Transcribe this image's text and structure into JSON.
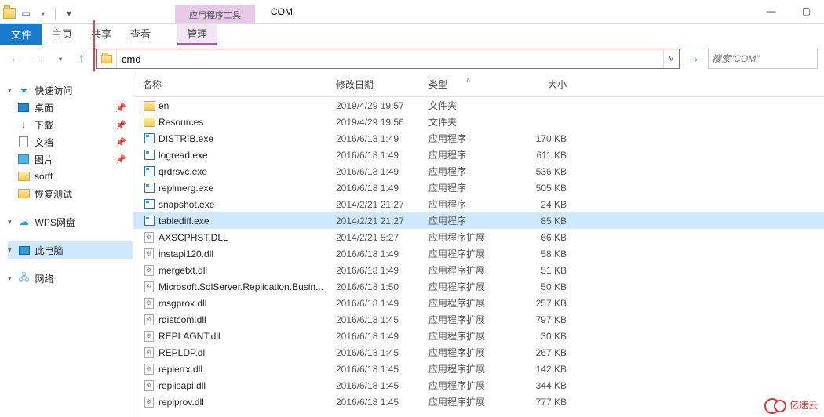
{
  "window": {
    "title": "COM",
    "tools_label": "应用程序工具"
  },
  "ribbon": {
    "file": "文件",
    "home": "主页",
    "share": "共享",
    "view": "查看",
    "manage": "管理"
  },
  "address": {
    "value": "cmd"
  },
  "search": {
    "placeholder": "搜索\"COM\""
  },
  "sidebar": {
    "quick_access": "快速访问",
    "items": [
      {
        "label": "桌面",
        "icon": "desktop",
        "pinned": true
      },
      {
        "label": "下载",
        "icon": "download",
        "pinned": true
      },
      {
        "label": "文档",
        "icon": "doc",
        "pinned": true
      },
      {
        "label": "图片",
        "icon": "pic",
        "pinned": true
      },
      {
        "label": "sorft",
        "icon": "folder",
        "pinned": false
      },
      {
        "label": "恢复测试",
        "icon": "folder",
        "pinned": false
      }
    ],
    "wps": "WPS网盘",
    "this_pc": "此电脑",
    "network": "网络"
  },
  "columns": {
    "name": "名称",
    "date": "修改日期",
    "type": "类型",
    "size": "大小"
  },
  "files": [
    {
      "name": "en",
      "date": "2019/4/29 19:57",
      "type": "文件夹",
      "size": "",
      "icon": "folder"
    },
    {
      "name": "Resources",
      "date": "2019/4/29 19:56",
      "type": "文件夹",
      "size": "",
      "icon": "folder"
    },
    {
      "name": "DISTRIB.exe",
      "date": "2016/6/18 1:49",
      "type": "应用程序",
      "size": "170 KB",
      "icon": "exe"
    },
    {
      "name": "logread.exe",
      "date": "2016/6/18 1:49",
      "type": "应用程序",
      "size": "611 KB",
      "icon": "exe"
    },
    {
      "name": "qrdrsvc.exe",
      "date": "2016/6/18 1:49",
      "type": "应用程序",
      "size": "536 KB",
      "icon": "exe"
    },
    {
      "name": "replmerg.exe",
      "date": "2016/6/18 1:49",
      "type": "应用程序",
      "size": "505 KB",
      "icon": "exe"
    },
    {
      "name": "snapshot.exe",
      "date": "2014/2/21 21:27",
      "type": "应用程序",
      "size": "24 KB",
      "icon": "exe"
    },
    {
      "name": "tablediff.exe",
      "date": "2014/2/21 21:27",
      "type": "应用程序",
      "size": "85 KB",
      "icon": "exe",
      "selected": true
    },
    {
      "name": "AXSCPHST.DLL",
      "date": "2014/2/21 5:27",
      "type": "应用程序扩展",
      "size": "66 KB",
      "icon": "dll"
    },
    {
      "name": "instapi120.dll",
      "date": "2016/6/18 1:49",
      "type": "应用程序扩展",
      "size": "58 KB",
      "icon": "dll"
    },
    {
      "name": "mergetxt.dll",
      "date": "2016/6/18 1:49",
      "type": "应用程序扩展",
      "size": "51 KB",
      "icon": "dll"
    },
    {
      "name": "Microsoft.SqlServer.Replication.Busin...",
      "date": "2016/6/18 1:50",
      "type": "应用程序扩展",
      "size": "50 KB",
      "icon": "dll"
    },
    {
      "name": "msgprox.dll",
      "date": "2016/6/18 1:49",
      "type": "应用程序扩展",
      "size": "257 KB",
      "icon": "dll"
    },
    {
      "name": "rdistcom.dll",
      "date": "2016/6/18 1:45",
      "type": "应用程序扩展",
      "size": "797 KB",
      "icon": "dll"
    },
    {
      "name": "REPLAGNT.dll",
      "date": "2016/6/18 1:49",
      "type": "应用程序扩展",
      "size": "30 KB",
      "icon": "dll"
    },
    {
      "name": "REPLDP.dll",
      "date": "2016/6/18 1:45",
      "type": "应用程序扩展",
      "size": "267 KB",
      "icon": "dll"
    },
    {
      "name": "replerrx.dll",
      "date": "2016/6/18 1:45",
      "type": "应用程序扩展",
      "size": "142 KB",
      "icon": "dll"
    },
    {
      "name": "replisapi.dll",
      "date": "2016/6/18 1:45",
      "type": "应用程序扩展",
      "size": "344 KB",
      "icon": "dll"
    },
    {
      "name": "replprov.dll",
      "date": "2016/6/18 1:45",
      "type": "应用程序扩展",
      "size": "777 KB",
      "icon": "dll"
    }
  ],
  "watermark": "亿速云"
}
